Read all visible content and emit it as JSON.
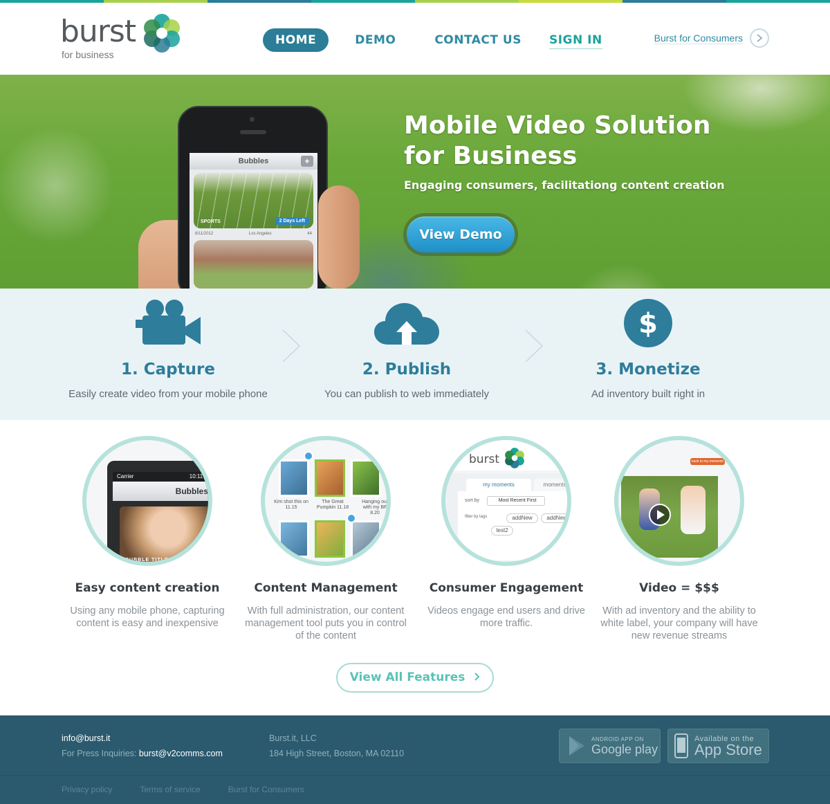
{
  "colors": {
    "stripe": [
      "#1aa39b",
      "#a7d14a",
      "#2b7d98",
      "#1aa39b",
      "#a7d14a",
      "#c8dc3c",
      "#2b7d98",
      "#1aa39b"
    ],
    "accent": "#2b7d98",
    "teal": "#1aa39b",
    "footer_bg": "#2b5a6e"
  },
  "header": {
    "logo_word": "burst",
    "logo_sub": "for business",
    "nav": [
      {
        "label": "HOME",
        "active": true
      },
      {
        "label": "DEMO",
        "active": false
      },
      {
        "label": "CONTACT US",
        "active": false
      },
      {
        "label": "SIGN IN",
        "active": false
      }
    ],
    "consumer_link": "Burst for Consumers",
    "consumer_icon": "chevron-right-circle-icon"
  },
  "hero": {
    "title_line1": "Mobile Video Solution",
    "title_line2": "for Business",
    "subtitle": "Engaging consumers, facilitationg content creation",
    "cta": "View Demo",
    "phone": {
      "screen_title": "Bubbles",
      "card_tag": "SPORTS",
      "card_badge": "2 Days Left",
      "card_date": "6/11/2012",
      "card_location": "Los Angeles",
      "card_count": "44"
    }
  },
  "steps": [
    {
      "title": "1. Capture",
      "desc": "Easily create video from your mobile phone",
      "icon": "video-camera-icon"
    },
    {
      "title": "2. Publish",
      "desc": "You can publish to web immediately",
      "icon": "cloud-upload-icon"
    },
    {
      "title": "3. Monetize",
      "desc": "Ad inventory built right in",
      "icon": "dollar-icon"
    }
  ],
  "features": [
    {
      "title": "Easy content creation",
      "desc": "Using any mobile phone, capturing content is easy and inexpensive",
      "carrier": "Carrier",
      "time": "10:11 AM",
      "screen": "Bubbles",
      "caption": "BUBBLE TITLE"
    },
    {
      "title": "Content Management",
      "desc": "With full administration, our content management tool puts you in control of the content",
      "captions": [
        "Kim shot this on 11.15",
        "The Great Pumpkin 11.18",
        "Hanging out with my BF 8.20"
      ]
    },
    {
      "title": "Consumer Engagement",
      "desc": "Videos engage end users and drive more traffic.",
      "logo": "burst",
      "tabs": [
        "my moments",
        "moments"
      ],
      "sort_label": "sort by",
      "sort_value": "Most Recent First",
      "filter_label": "filter by tags",
      "tags": [
        "addNew",
        "addNew",
        "test2"
      ]
    },
    {
      "title": "Video = $$$",
      "desc": "With ad inventory and the ability to white label, your company will have new revenue streams",
      "back": "back to my moments"
    }
  ],
  "view_all": "View All Features",
  "footer": {
    "email": "info@burst.it",
    "press_label": "For Press Inquiries:",
    "press_email": "burst@v2comms.com",
    "company": "Burst.it, LLC",
    "address": "184 High Street, Boston, MA 02110",
    "links": [
      "Privacy policy",
      "Terms of service",
      "Burst for Consumers"
    ],
    "google_small": "ANDROID APP ON",
    "google_big": "Google play",
    "apple_small": "Available on the",
    "apple_big": "App Store"
  }
}
